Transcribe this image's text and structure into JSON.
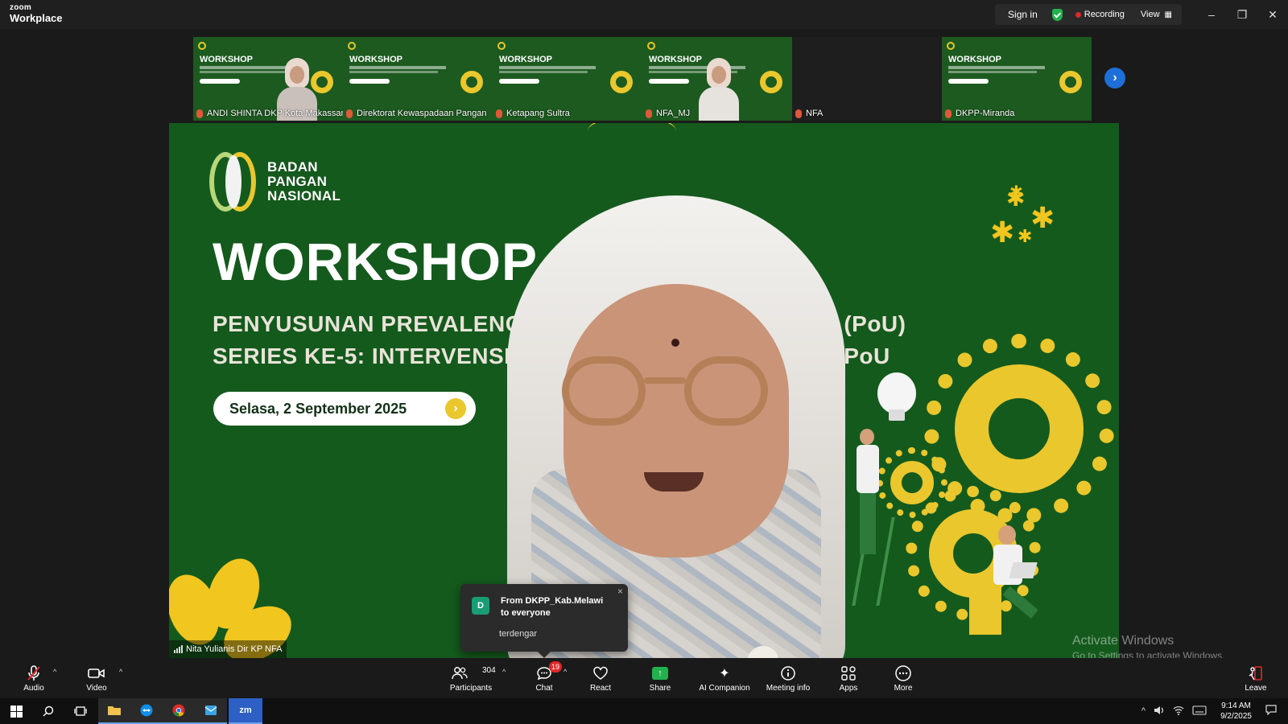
{
  "titlebar": {
    "brand_top": "zoom",
    "brand_bottom": "Workplace",
    "sign_in": "Sign in",
    "recording": "Recording",
    "view": "View",
    "minimize": "–",
    "restore": "❐",
    "close": "✕"
  },
  "thumbnails": [
    {
      "name": "ANDI SHINTA DKP Kota Makassar",
      "title": "WORKSHOP",
      "has_video": true
    },
    {
      "name": "Direktorat Kewaspadaan Pangan",
      "title": "WORKSHOP",
      "has_video": false
    },
    {
      "name": "Ketapang Sultra",
      "title": "WORKSHOP",
      "has_video": false
    },
    {
      "name": "NFA_MJ",
      "title": "WORKSHOP",
      "has_video": true
    },
    {
      "name": "NFA",
      "title": "",
      "has_video": false
    },
    {
      "name": "DKPP-Miranda",
      "title": "WORKSHOP",
      "has_video": false
    }
  ],
  "strip_next": "›",
  "slide": {
    "logo_lines": [
      "BADAN",
      "PANGAN",
      "NASIONAL"
    ],
    "title": "WORKSHOP",
    "subtitle_line1": "PENYUSUNAN PREVALENCE OF UNDERNOURISHMENT (PoU)",
    "subtitle_line2": "SERIES KE-5: INTERVENSI BERBASIS DATA INDIKATOR PoU",
    "date": "Selasa, 2 September 2025",
    "date_arrow": "›"
  },
  "speaker_name": "Nita Yulianis Dir KP NFA",
  "watermark": {
    "line1": "Activate Windows",
    "line2": "Go to Settings to activate Windows."
  },
  "chat_popup": {
    "avatar": "D",
    "from": "From DKPP_Kab.Melawi to everyone",
    "message": "terdengar",
    "close": "×"
  },
  "toolbar": {
    "audio": "Audio",
    "video": "Video",
    "participants": "Participants",
    "participants_count": "304",
    "chat": "Chat",
    "chat_badge": "19",
    "react": "React",
    "share": "Share",
    "ai_companion": "AI Companion",
    "meeting_info": "Meeting info",
    "apps": "Apps",
    "more": "More",
    "leave": "Leave"
  },
  "taskbar": {
    "time": "9:14 AM",
    "date": "9/2/2025"
  },
  "colors": {
    "slide_green": "#145a1d",
    "accent_yellow": "#e9c72d",
    "recording_red": "#e02828",
    "chat_badge_red": "#e02828",
    "share_green": "#23b14d",
    "strip_arrow_blue": "#1e6fd9"
  }
}
